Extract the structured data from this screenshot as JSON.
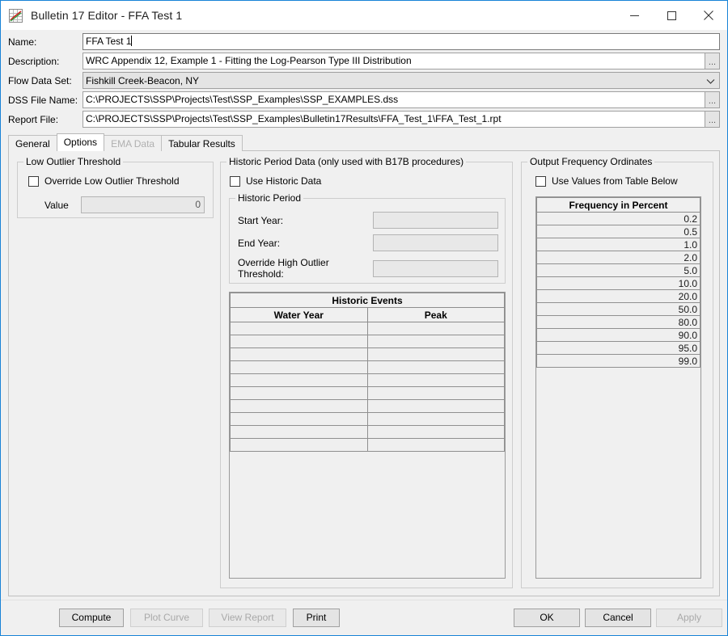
{
  "window": {
    "title": "Bulletin 17 Editor - FFA Test 1",
    "icon": "chart-line-icon",
    "minimize_label": "–",
    "maximize_label": "☐",
    "close_label": "✕",
    "accent_color": "#1883d7"
  },
  "form": {
    "name": {
      "label": "Name:",
      "value": "FFA Test 1"
    },
    "description": {
      "label": "Description:",
      "value": "WRC Appendix 12, Example 1 - Fitting the Log-Pearson Type III Distribution",
      "browse_label": "..."
    },
    "flow_data_set": {
      "label": "Flow Data Set:",
      "value": "Fishkill Creek-Beacon, NY",
      "chevron": "⌄"
    },
    "dss_file_name": {
      "label": "DSS File Name:",
      "value": "C:\\PROJECTS\\SSP\\Projects\\Test\\SSP_Examples\\SSP_EXAMPLES.dss",
      "browse_label": "..."
    },
    "report_file": {
      "label": "Report File:",
      "value": "C:\\PROJECTS\\SSP\\Projects\\Test\\SSP_Examples\\Bulletin17Results\\FFA_Test_1\\FFA_Test_1.rpt",
      "browse_label": "..."
    }
  },
  "tabs": [
    {
      "label": "General",
      "state": "normal"
    },
    {
      "label": "Options",
      "state": "active"
    },
    {
      "label": "EMA Data",
      "state": "disabled"
    },
    {
      "label": "Tabular Results",
      "state": "normal"
    }
  ],
  "low_outlier": {
    "group_label": "Low Outlier Threshold",
    "override_checkbox_label": "Override Low Outlier Threshold",
    "override_checked": false,
    "value_label": "Value",
    "value": "0"
  },
  "historic": {
    "group_label": "Historic Period Data (only used with B17B procedures)",
    "use_historic_label": "Use Historic Data",
    "use_historic_checked": false,
    "period_group_label": "Historic Period",
    "start_year_label": "Start Year:",
    "start_year_value": "",
    "end_year_label": "End Year:",
    "end_year_value": "",
    "override_high_label": "Override High Outlier Threshold:",
    "override_high_value": "",
    "events_title": "Historic Events",
    "events_columns": [
      "Water Year",
      "Peak"
    ],
    "events_rows": [
      [
        "",
        ""
      ],
      [
        "",
        ""
      ],
      [
        "",
        ""
      ],
      [
        "",
        ""
      ],
      [
        "",
        ""
      ],
      [
        "",
        ""
      ],
      [
        "",
        ""
      ],
      [
        "",
        ""
      ],
      [
        "",
        ""
      ],
      [
        "",
        ""
      ]
    ]
  },
  "output_frequency": {
    "group_label": "Output Frequency Ordinates",
    "use_table_label": "Use Values from Table Below",
    "use_table_checked": false,
    "column_header": "Frequency in Percent",
    "values": [
      "0.2",
      "0.5",
      "1.0",
      "2.0",
      "5.0",
      "10.0",
      "20.0",
      "50.0",
      "80.0",
      "90.0",
      "95.0",
      "99.0"
    ]
  },
  "buttons": {
    "compute": {
      "label": "Compute",
      "enabled": true
    },
    "plot_curve": {
      "label": "Plot Curve",
      "enabled": false
    },
    "view_report": {
      "label": "View Report",
      "enabled": false
    },
    "print": {
      "label": "Print",
      "enabled": true
    },
    "ok": {
      "label": "OK",
      "enabled": true
    },
    "cancel": {
      "label": "Cancel",
      "enabled": true
    },
    "apply": {
      "label": "Apply",
      "enabled": false
    }
  }
}
